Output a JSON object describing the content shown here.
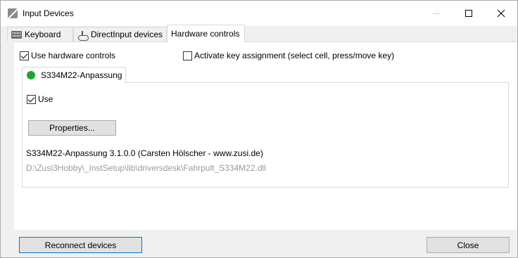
{
  "window": {
    "title": "Input Devices"
  },
  "tabs": [
    {
      "label": "Keyboard",
      "icon": "keyboard-icon",
      "active": false
    },
    {
      "label": "DirectInput devices",
      "icon": "joystick-icon",
      "active": false
    },
    {
      "label": "Hardware controls",
      "active": true
    }
  ],
  "hardware": {
    "use_hw_label": "Use hardware controls",
    "use_hw_checked": true,
    "activate_label": "Activate key assignment (select cell, press/move key)",
    "activate_checked": false
  },
  "device_tab": {
    "label": "S334M22-Anpassung",
    "status_color": "#1fa52a"
  },
  "device": {
    "use_label": "Use",
    "use_checked": true,
    "properties_label": "Properties...",
    "info": "S334M22-Anpassung  3.1.0.0 (Carsten Hölscher - www.zusi.de)",
    "path": "D:\\Zusi3Hobby\\_InstSetup\\lib\\driversdesk\\Fahrpult_S334M22.dll"
  },
  "footer": {
    "reconnect_label": "Reconnect devices",
    "close_label": "Close"
  }
}
